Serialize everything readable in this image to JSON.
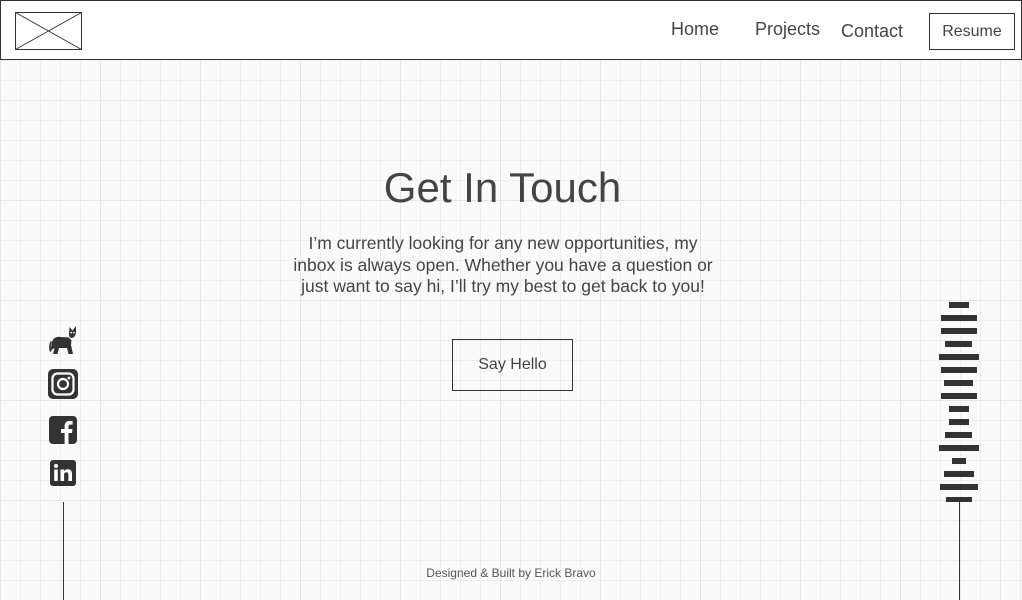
{
  "nav": {
    "links": [
      {
        "label": "Home"
      },
      {
        "label": "Projects"
      },
      {
        "label": "Contact"
      }
    ],
    "resume_label": "Resume"
  },
  "contact": {
    "title": "Get In Touch",
    "description": "I’m currently looking for any new opportunities, my inbox is always open. Whether you have a question or just want to say hi, I’ll try my best to get back to you!",
    "button_label": "Say Hello"
  },
  "social_icons": [
    "github-icon",
    "instagram-icon",
    "facebook-icon",
    "linkedin-icon"
  ],
  "footer": {
    "text": "Designed & Built by Erick Bravo"
  },
  "colors": {
    "text": "#444444",
    "border": "#333333",
    "background": "#fafafa",
    "grid_line": "#e4e4e4"
  }
}
